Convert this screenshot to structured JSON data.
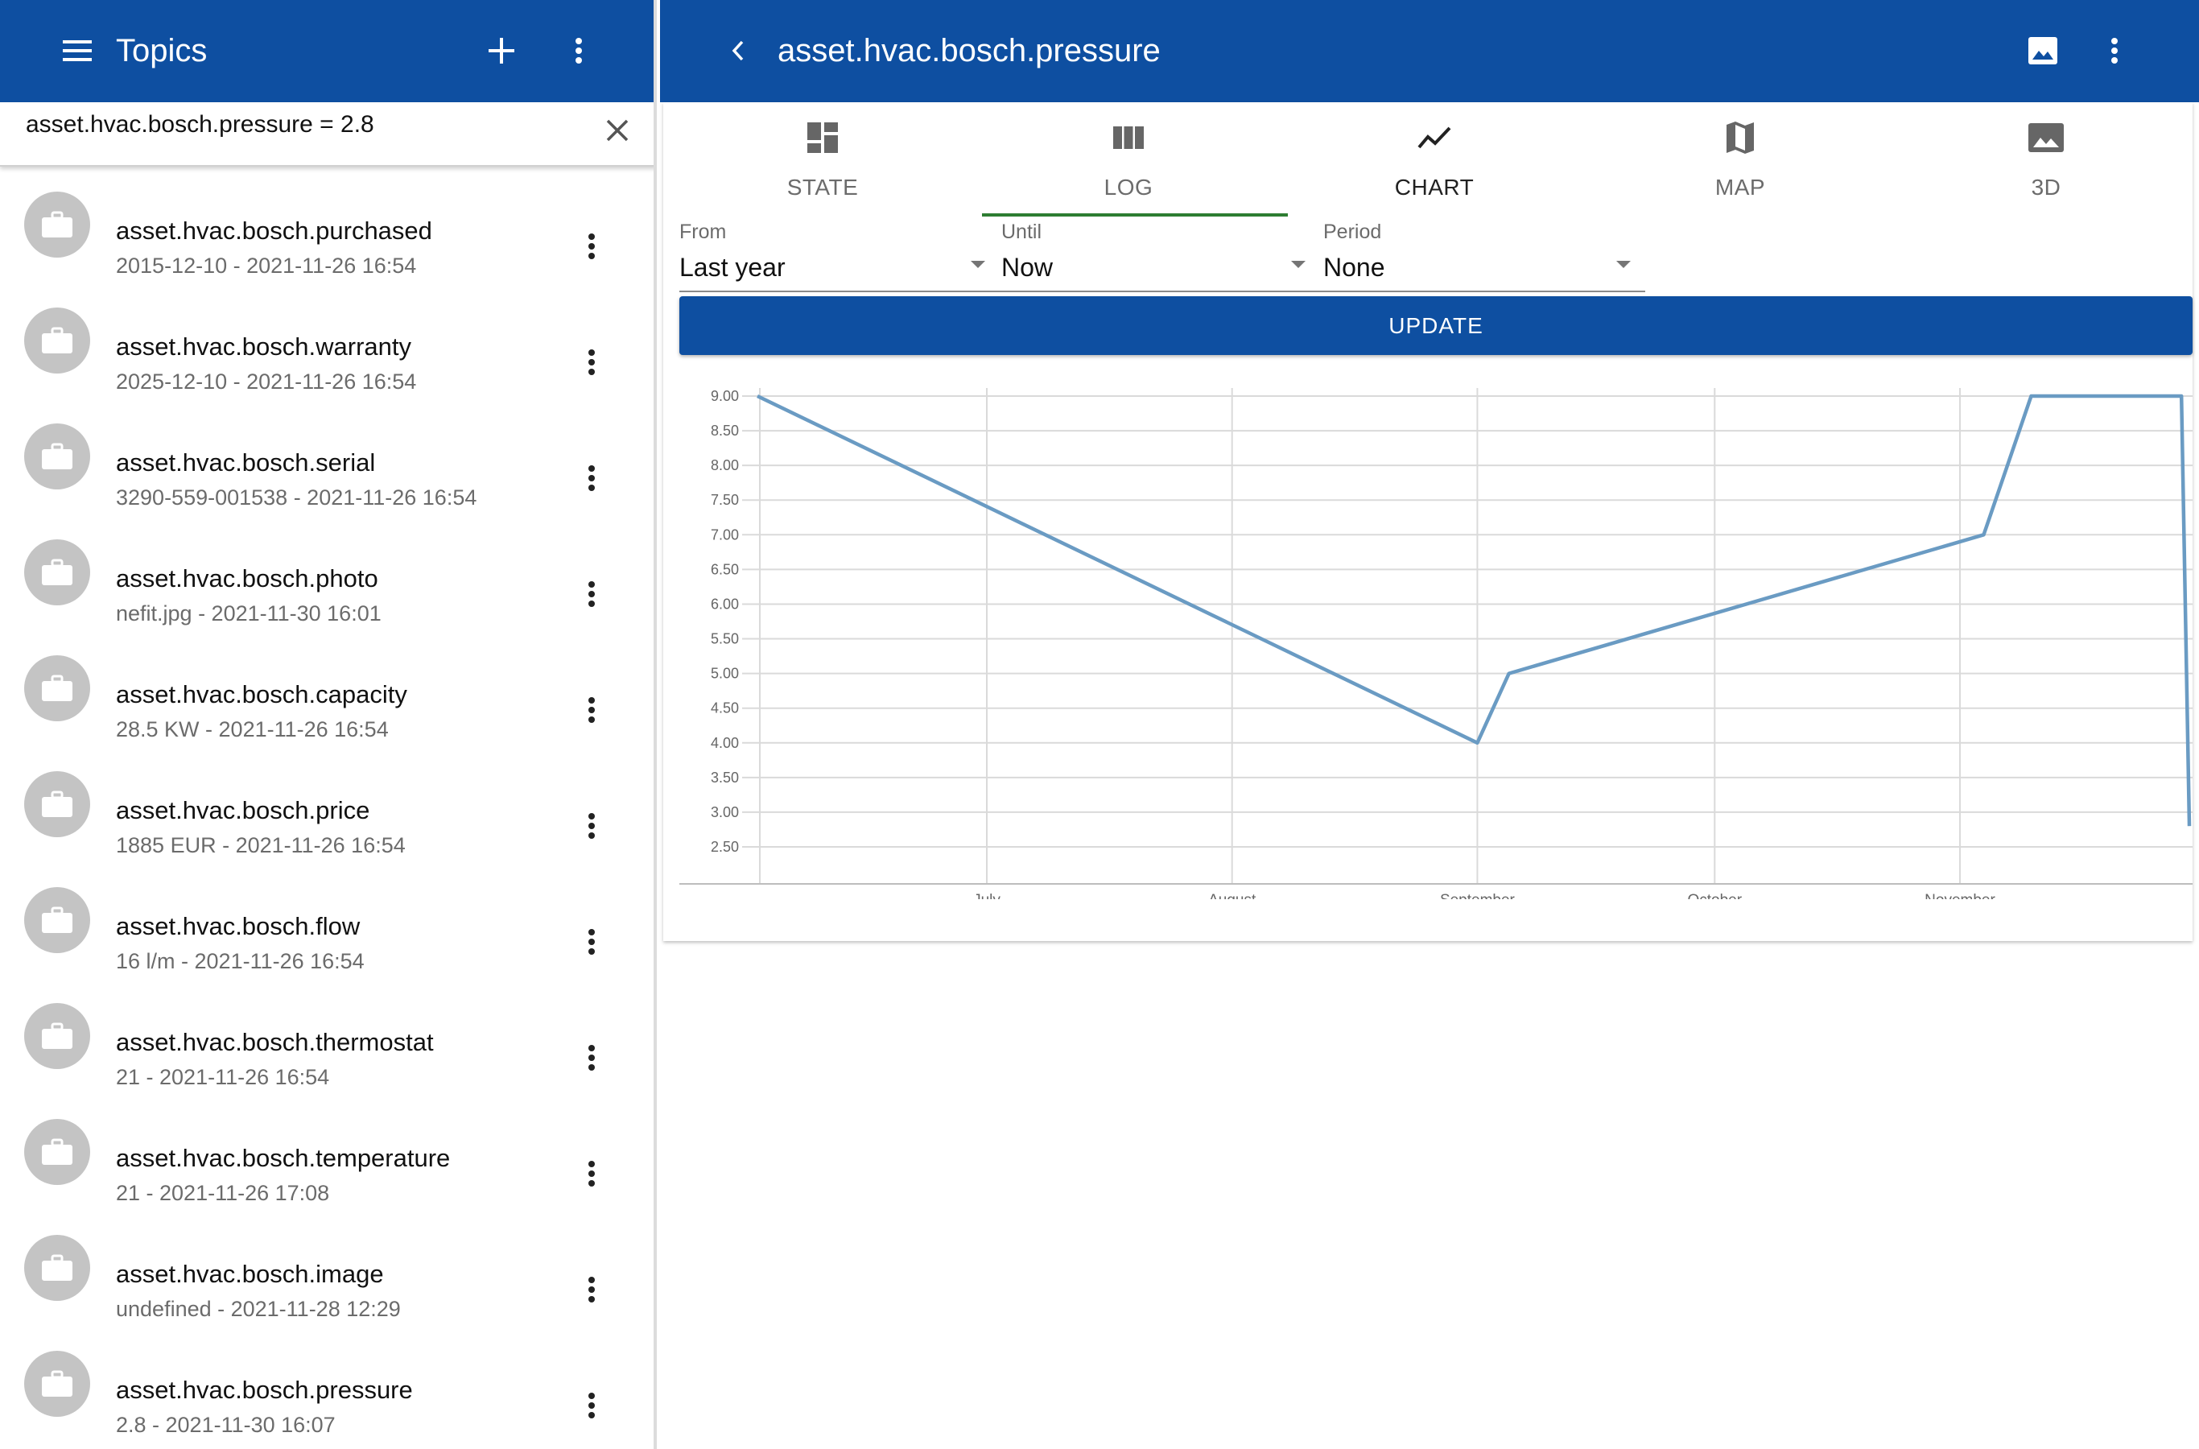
{
  "left": {
    "appbar": {
      "title": "Topics",
      "menu_icon": "hamburger-menu-icon",
      "add_icon": "plus-icon",
      "more_icon": "more-vert-icon"
    },
    "search": {
      "value": "asset.hvac.bosch.pressure = 2.8",
      "clear_icon": "close-icon"
    },
    "topics": [
      {
        "name": "asset.hvac.bosch.purchased",
        "sub": "2015-12-10 - 2021-11-26 16:54"
      },
      {
        "name": "asset.hvac.bosch.warranty",
        "sub": "2025-12-10 - 2021-11-26 16:54"
      },
      {
        "name": "asset.hvac.bosch.serial",
        "sub": "3290-559-001538 - 2021-11-26 16:54"
      },
      {
        "name": "asset.hvac.bosch.photo",
        "sub": "nefit.jpg - 2021-11-30 16:01"
      },
      {
        "name": "asset.hvac.bosch.capacity",
        "sub": "28.5 KW - 2021-11-26 16:54"
      },
      {
        "name": "asset.hvac.bosch.price",
        "sub": "1885 EUR - 2021-11-26 16:54"
      },
      {
        "name": "asset.hvac.bosch.flow",
        "sub": "16 l/m - 2021-11-26 16:54"
      },
      {
        "name": "asset.hvac.bosch.thermostat",
        "sub": "21 - 2021-11-26 16:54"
      },
      {
        "name": "asset.hvac.bosch.temperature",
        "sub": "21 - 2021-11-26 17:08"
      },
      {
        "name": "asset.hvac.bosch.image",
        "sub": "undefined - 2021-11-28 12:29"
      },
      {
        "name": "asset.hvac.bosch.pressure",
        "sub": "2.8 - 2021-11-30 16:07"
      }
    ]
  },
  "right": {
    "appbar": {
      "title": "asset.hvac.bosch.pressure",
      "back_icon": "chevron-left-icon",
      "image_icon": "image-icon",
      "more_icon": "more-vert-icon"
    },
    "tabs": [
      {
        "label": "STATE",
        "icon": "dashboard-icon"
      },
      {
        "label": "LOG",
        "icon": "view-column-icon"
      },
      {
        "label": "CHART",
        "icon": "line-chart-icon"
      },
      {
        "label": "MAP",
        "icon": "map-icon"
      },
      {
        "label": "3D",
        "icon": "image-icon"
      }
    ],
    "active_tab": "CHART",
    "underlined_tab": "LOG",
    "filters": {
      "from": {
        "label": "From",
        "value": "Last year"
      },
      "until": {
        "label": "Until",
        "value": "Now"
      },
      "period": {
        "label": "Period",
        "value": "None"
      }
    },
    "update_label": "UPDATE"
  },
  "colors": {
    "appbar": "#0e4fa1",
    "line": "#6a9bc3",
    "tab_underline": "#2e7d32",
    "avatar": "#c4c4c4"
  },
  "chart_data": {
    "type": "line",
    "title": "",
    "xlabel": "",
    "ylabel": "",
    "ylim": [
      2.5,
      9.0
    ],
    "yticks": [
      "9.00",
      "8.50",
      "8.00",
      "7.50",
      "7.00",
      "6.50",
      "6.00",
      "5.50",
      "5.00",
      "4.50",
      "4.00",
      "3.50",
      "3.00",
      "2.50"
    ],
    "xticks": [
      "July",
      "August",
      "September",
      "October",
      "November"
    ],
    "grid": true,
    "series": [
      {
        "points": [
          {
            "x": "2021-06-02",
            "y": 9.0
          },
          {
            "x": "2021-09-01",
            "y": 4.0
          },
          {
            "x": "2021-09-05",
            "y": 5.0
          },
          {
            "x": "2021-11-04",
            "y": 7.0
          },
          {
            "x": "2021-11-10",
            "y": 9.0
          },
          {
            "x": "2021-11-29",
            "y": 9.0
          },
          {
            "x": "2021-11-30",
            "y": 2.8
          }
        ]
      }
    ]
  }
}
